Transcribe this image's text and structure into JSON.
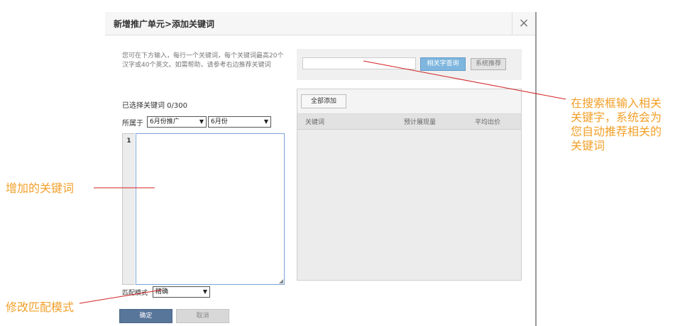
{
  "dialog": {
    "title": "新增推广单元>添加关键词",
    "close_glyph": "×",
    "help_text": "您可在下方输入，每行一个关键词，每个关键词最高20个汉字或40个英文。如需帮助，请参考右边推荐关键词",
    "selected_count": "已选择关键词 0/300",
    "belong_label": "所属于",
    "plan_select": "6月份推广",
    "unit_select": "6月份",
    "line_number": "1",
    "match_label": "匹配模式",
    "match_select": "精确",
    "ok_label": "确定",
    "cancel_label": "取消"
  },
  "search": {
    "query_button": "相关字查询",
    "recommend_button": "系统推荐",
    "input_value": ""
  },
  "results": {
    "add_all_button": "全部添加",
    "columns": [
      "关键词",
      "预计展现量",
      "平均出价"
    ]
  },
  "annotations": {
    "search_tip": "在搜索框输入相关关键字，系统会为您自动推荐相关的关键词",
    "added_keywords": "增加的关键词",
    "match_mode": "修改匹配模式"
  },
  "colors": {
    "annotation": "#f2a02a",
    "arrow_line": "#d22222",
    "primary_button": "#58759a",
    "search_button": "#7fb6de"
  }
}
